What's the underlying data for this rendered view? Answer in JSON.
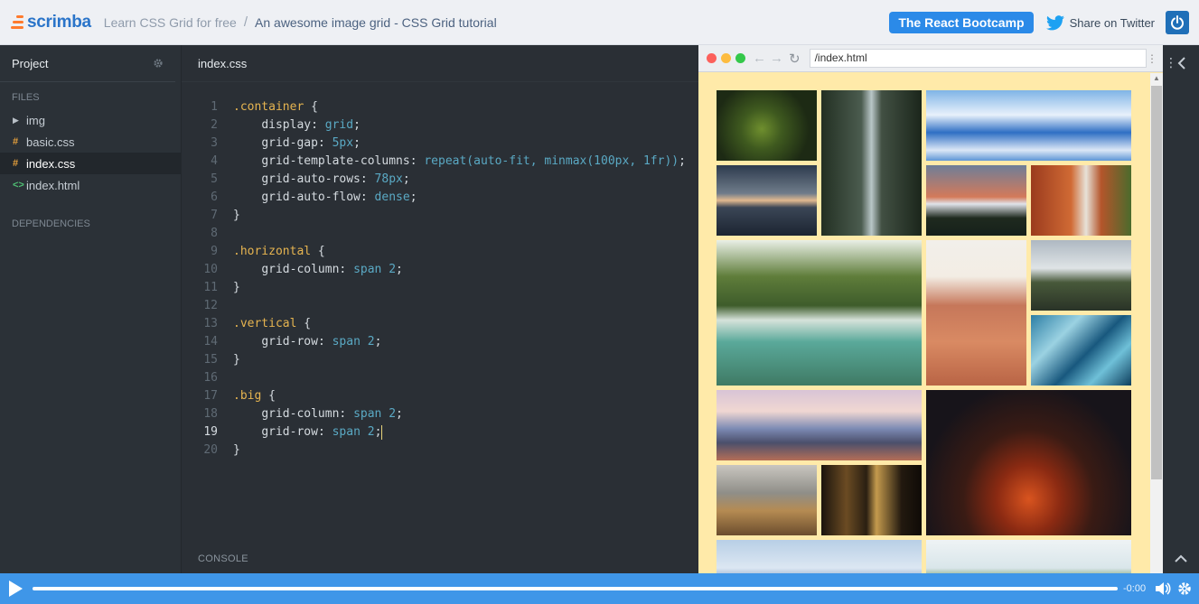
{
  "topbar": {
    "logo": "scrimba",
    "breadcrumb_course": "Learn CSS Grid for free",
    "separator": "/",
    "breadcrumb_title": "An awesome image grid - CSS Grid tutorial",
    "bootcamp_label": "The React Bootcamp",
    "twitter_label": "Share on Twitter",
    "accent_color": "#2b8ae8",
    "logo_color": "#2a74c9"
  },
  "sidebar": {
    "title": "Project",
    "files_heading": "FILES",
    "files": [
      {
        "name": "img",
        "icon": "folder-triangle-icon"
      },
      {
        "name": "basic.css",
        "icon": "hash-icon"
      },
      {
        "name": "index.css",
        "icon": "hash-icon",
        "active": true
      },
      {
        "name": "index.html",
        "icon": "code-brackets-icon"
      }
    ],
    "dependencies_heading": "DEPENDENCIES"
  },
  "editor": {
    "active_tab": "index.css",
    "console_label": "CONSOLE",
    "current_line": 19,
    "lines": [
      ".container {",
      "    display: grid;",
      "    grid-gap: 5px;",
      "    grid-template-columns: repeat(auto-fit, minmax(100px, 1fr));",
      "    grid-auto-rows: 78px;",
      "    grid-auto-flow: dense;",
      "}",
      "",
      ".horizontal {",
      "    grid-column: span 2;",
      "}",
      "",
      ".vertical {",
      "    grid-row: span 2;",
      "}",
      "",
      ".big {",
      "    grid-column: span 2;",
      "    grid-row: span 2;",
      "}"
    ]
  },
  "browser": {
    "url": "/index.html",
    "background": "#ffeaa9",
    "tiles": [
      {
        "cls": "tile",
        "desc": "moss-forest"
      },
      {
        "cls": "tile vertical",
        "desc": "waterfall-forest"
      },
      {
        "cls": "tile horizontal",
        "desc": "blue-mountains-clouds"
      },
      {
        "cls": "tile",
        "desc": "lake-sunset"
      },
      {
        "cls": "tile",
        "desc": "snowy-peak-sunset"
      },
      {
        "cls": "tile",
        "desc": "red-canyon-waterfall"
      },
      {
        "cls": "tile big",
        "desc": "waterfall-lagoon"
      },
      {
        "cls": "tile vertical",
        "desc": "desert-canyon"
      },
      {
        "cls": "tile",
        "desc": "boulders-field"
      },
      {
        "cls": "tile",
        "desc": "icy-waves"
      },
      {
        "cls": "tile horizontal",
        "desc": "pink-mountain-range"
      },
      {
        "cls": "tile big",
        "desc": "night-red-rock"
      },
      {
        "cls": "tile",
        "desc": "golden-hills"
      },
      {
        "cls": "tile",
        "desc": "dark-forest-path"
      },
      {
        "cls": "tile horizontal",
        "desc": "blue-hills"
      },
      {
        "cls": "tile horizontal",
        "desc": "green-tree"
      }
    ]
  },
  "player": {
    "time": "-0:00",
    "color": "#3f96e8"
  }
}
